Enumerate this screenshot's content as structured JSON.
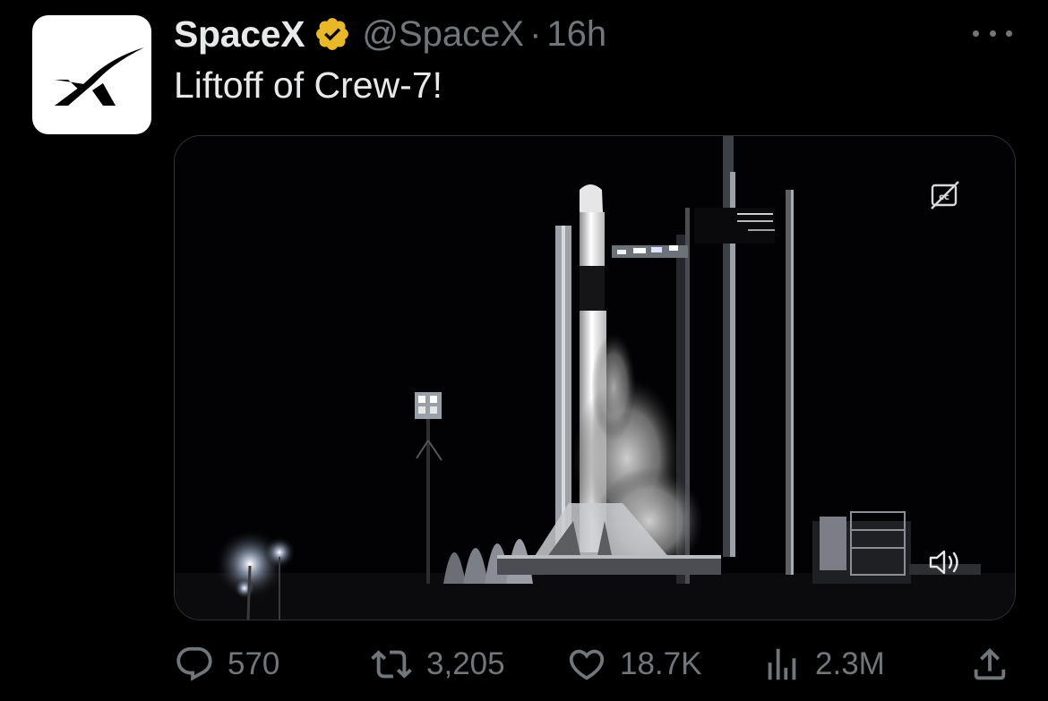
{
  "tweet": {
    "display_name": "SpaceX",
    "handle": "@SpaceX",
    "separator": "·",
    "time": "16h",
    "text": "Liftoff of Crew-7!",
    "verified": true,
    "verified_color": "#E8B827"
  },
  "icons": {
    "avatar": "spacex-logo-icon",
    "verified": "verified-badge-icon",
    "more": "more-options-icon",
    "captions": "closed-captions-icon",
    "volume": "volume-muted-icon",
    "reply": "reply-icon",
    "retweet": "retweet-icon",
    "like": "heart-icon",
    "views": "views-chart-icon",
    "share": "share-icon"
  },
  "stats": {
    "replies": "570",
    "retweets": "3,205",
    "likes": "18.7K",
    "views": "2.3M"
  },
  "colors": {
    "background": "#000000",
    "text_primary": "#e7e9ea",
    "text_secondary": "#71767b",
    "border": "#2f3336"
  }
}
